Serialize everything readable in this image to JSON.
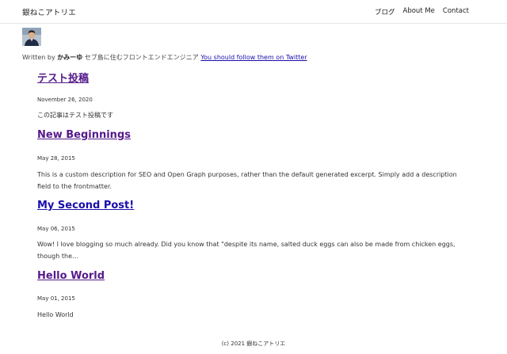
{
  "header": {
    "site_title": "銀ねこアトリエ",
    "nav": [
      {
        "label": "ブログ"
      },
      {
        "label": "About Me"
      },
      {
        "label": "Contact"
      }
    ]
  },
  "bio": {
    "prefix": "Written by ",
    "author": "かみーゆ",
    "description": " セブ島に住むフロントエンドエンジニア ",
    "link": "You should follow them on Twitter"
  },
  "posts": [
    {
      "title": "テスト投稿",
      "date": "November 26, 2020",
      "description": "この記事はテスト投稿です",
      "visited": true
    },
    {
      "title": "New Beginnings",
      "date": "May 28, 2015",
      "description": "This is a custom description for SEO and Open Graph purposes, rather than the default generated excerpt. Simply add a description field to the frontmatter.",
      "visited": true
    },
    {
      "title": "My Second Post!",
      "date": "May 06, 2015",
      "description": "Wow! I love blogging so much already. Did you know that \"despite its name, salted duck eggs can also be made from chicken eggs, though the…",
      "visited": false
    },
    {
      "title": "Hello World",
      "date": "May 01, 2015",
      "description": "Hello World",
      "visited": true
    }
  ],
  "footer": {
    "text": "(c) 2021 銀ねこアトリエ"
  },
  "colors": {
    "visited_link": "#551a8b",
    "unvisited_link": "#1a0dab",
    "text": "#333333",
    "divider": "#e6e6e6"
  }
}
